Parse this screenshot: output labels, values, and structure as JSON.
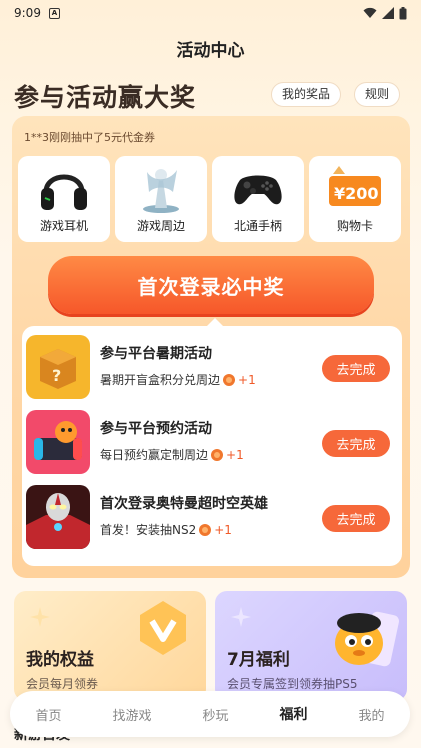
{
  "status_bar": {
    "time": "9:09",
    "notification_badge": "A"
  },
  "header": {
    "title": "活动中心"
  },
  "hero": {
    "title": "参与活动赢大奖",
    "my_prizes": "我的奖品",
    "rules": "规则"
  },
  "ticker": "1**3刚刚抽中了5元代金券",
  "prizes": [
    {
      "label": "游戏耳机",
      "icon": "headphones-icon"
    },
    {
      "label": "游戏周边",
      "icon": "figurine-icon"
    },
    {
      "label": "北通手柄",
      "icon": "gamepad-icon"
    },
    {
      "label": "购物卡",
      "icon": "shopping-card-icon",
      "card_value": "¥200"
    }
  ],
  "main_button": "首次登录必中奖",
  "tasks": [
    {
      "title": "参与平台暑期活动",
      "subtitle": "暑期开盲盒积分兑周边",
      "reward": "+1",
      "action": "去完成"
    },
    {
      "title": "参与平台预约活动",
      "subtitle": "每日预约赢定制周边",
      "reward": "+1",
      "action": "去完成"
    },
    {
      "title": "首次登录奥特曼超时空英雄",
      "subtitle": "首发！安装抽NS2",
      "reward": "+1",
      "action": "去完成"
    }
  ],
  "benefits": [
    {
      "title": "我的权益",
      "subtitle": "会员每月领券"
    },
    {
      "title": "7月福利",
      "subtitle": "会员专属签到领券抽PS5"
    }
  ],
  "cutoff_text": "新游首发",
  "bottom_nav": [
    {
      "label": "首页",
      "active": false
    },
    {
      "label": "找游戏",
      "active": false
    },
    {
      "label": "秒玩",
      "active": false
    },
    {
      "label": "福利",
      "active": true
    },
    {
      "label": "我的",
      "active": false
    }
  ],
  "colors": {
    "accent": "#f6572a",
    "card_bg": "#ffd8a8",
    "page_bg": "#fff4e2"
  }
}
